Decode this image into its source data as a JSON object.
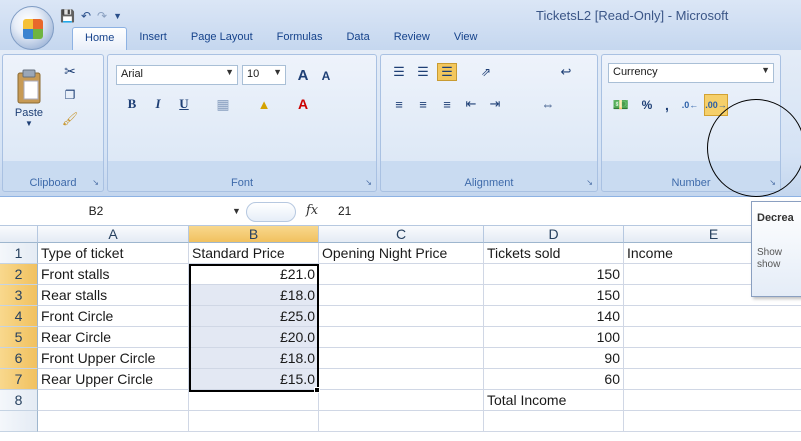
{
  "window": {
    "title": "TicketsL2  [Read-Only]  - Microsoft"
  },
  "quick_access": {
    "save_icon": "save-icon",
    "undo_icon": "undo-icon",
    "redo_icon": "redo-icon"
  },
  "tabs": [
    {
      "label": "Home"
    },
    {
      "label": "Insert"
    },
    {
      "label": "Page Layout"
    },
    {
      "label": "Formulas"
    },
    {
      "label": "Data"
    },
    {
      "label": "Review"
    },
    {
      "label": "View"
    }
  ],
  "ribbon": {
    "clipboard": {
      "label": "Clipboard",
      "paste": "Paste"
    },
    "font": {
      "label": "Font",
      "name": "Arial",
      "size": "10",
      "bold": "B",
      "italic": "I",
      "underline": "U",
      "grow": "A",
      "shrink": "A",
      "font_color": "A"
    },
    "alignment": {
      "label": "Alignment"
    },
    "number": {
      "label": "Number",
      "format": "Currency",
      "percent": "%",
      "comma": ","
    }
  },
  "formula_bar": {
    "name_box": "B2",
    "fx": "fx",
    "value": "21"
  },
  "columns": [
    "A",
    "B",
    "C",
    "D",
    "E"
  ],
  "rows": [
    {
      "num": "1",
      "a": "Type of ticket",
      "b": "Standard Price",
      "c": "Opening Night Price",
      "d": "Tickets sold",
      "e": "Income"
    },
    {
      "num": "2",
      "a": "Front stalls",
      "b": "£21.0",
      "c": "",
      "d": "150",
      "e": ""
    },
    {
      "num": "3",
      "a": "Rear stalls",
      "b": "£18.0",
      "c": "",
      "d": "150",
      "e": ""
    },
    {
      "num": "4",
      "a": "Front Circle",
      "b": "£25.0",
      "c": "",
      "d": "140",
      "e": ""
    },
    {
      "num": "5",
      "a": "Rear Circle",
      "b": "£20.0",
      "c": "",
      "d": "100",
      "e": ""
    },
    {
      "num": "6",
      "a": "Front Upper Circle",
      "b": "£18.0",
      "c": "",
      "d": "90",
      "e": ""
    },
    {
      "num": "7",
      "a": "Rear Upper Circle",
      "b": "£15.0",
      "c": "",
      "d": "60",
      "e": ""
    },
    {
      "num": "8",
      "a": "",
      "b": "",
      "c": "",
      "d": "Total Income",
      "e": ""
    }
  ],
  "tooltip": {
    "title": "Decrea",
    "body": "Show show"
  }
}
